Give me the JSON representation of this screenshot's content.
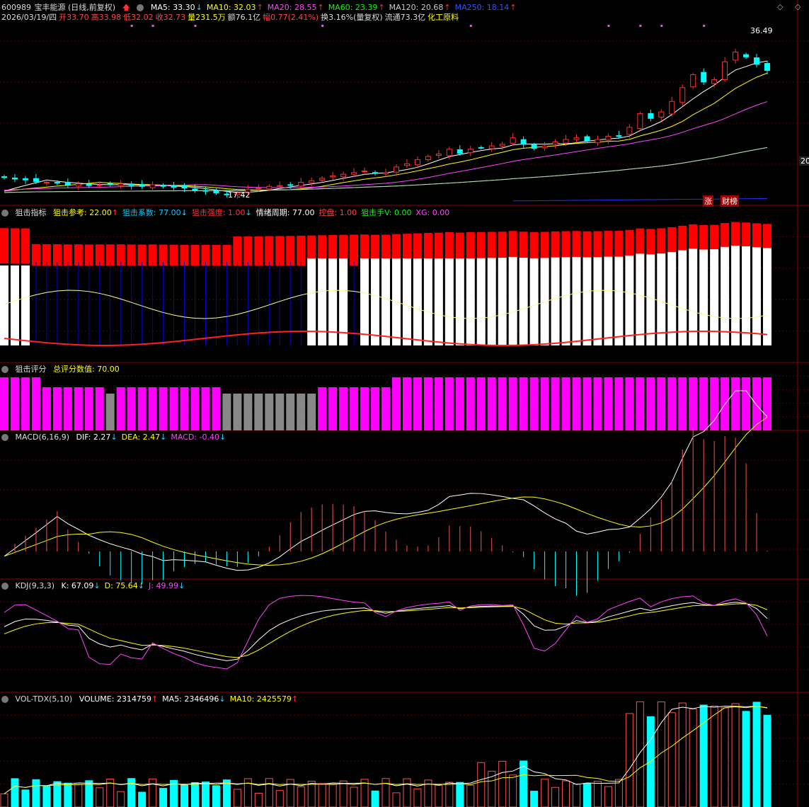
{
  "header": {
    "code": "600989",
    "name": "宝丰能源",
    "mode": "(日线,前复权)",
    "ma": [
      {
        "label": "MA5: 33.30",
        "dir": "down",
        "color": "#ffffff"
      },
      {
        "label": "MA10: 32.03",
        "dir": "up",
        "color": "#ffff00"
      },
      {
        "label": "MA20: 28.55",
        "dir": "up",
        "color": "#ff44ff"
      },
      {
        "label": "MA60: 23.39",
        "dir": "up",
        "color": "#00ff00"
      },
      {
        "label": "MA120: 20.68",
        "dir": "up",
        "color": "#cccccc"
      },
      {
        "label": "MA250: 18.14",
        "dir": "up",
        "color": "#3355ff"
      }
    ],
    "info": [
      {
        "t": "2026/03/19/四",
        "c": "#dddddd"
      },
      {
        "t": "开33.70",
        "c": "#ff4444"
      },
      {
        "t": "高33.98",
        "c": "#ff4444"
      },
      {
        "t": "低32.02",
        "c": "#ff4444"
      },
      {
        "t": "收32.73",
        "c": "#ff4444"
      },
      {
        "t": "量231.5万",
        "c": "#ffff00"
      },
      {
        "t": "额76.1亿",
        "c": "#dddddd"
      },
      {
        "t": "幅0.77(2.41%)",
        "c": "#ff4444"
      },
      {
        "t": "换3.16%(量复权)",
        "c": "#dddddd"
      },
      {
        "t": "流通73.3亿",
        "c": "#dddddd"
      },
      {
        "t": "化工原料",
        "c": "#ffff00"
      }
    ],
    "high_label": "36.49",
    "low_label": "17.42",
    "right_label": "20",
    "tag1": "涨",
    "tag2": "财榜"
  },
  "panel_sniper": {
    "title": "狙击指标",
    "items": [
      {
        "t": "狙击参考: 22.00",
        "c": "#ffff00",
        "dir": "up"
      },
      {
        "t": "狙击系数: 77.00",
        "c": "#00ccff",
        "dir": "down"
      },
      {
        "t": "狙击强度: 1.00",
        "c": "#ff3333",
        "dir": "down"
      },
      {
        "t": "情绪周期: 77.00",
        "c": "#ffffff",
        "dir": ""
      },
      {
        "t": "控盘: 1.00",
        "c": "#ff4444",
        "dir": ""
      },
      {
        "t": "狙击手V: 0.00",
        "c": "#00ff00",
        "dir": ""
      },
      {
        "t": "XG: 0.00",
        "c": "#ff44ff",
        "dir": ""
      }
    ]
  },
  "panel_score": {
    "title": "狙击评分",
    "items": [
      {
        "t": "总评分数值: 70.00",
        "c": "#ffff00",
        "dir": ""
      }
    ]
  },
  "panel_macd": {
    "title": "MACD(6,16,9)",
    "items": [
      {
        "t": "DIF: 2.27",
        "c": "#ffffff",
        "dir": "down"
      },
      {
        "t": "DEA: 2.47",
        "c": "#ffff00",
        "dir": "down"
      },
      {
        "t": "MACD: -0.40",
        "c": "#ff44ff",
        "dir": "down"
      }
    ]
  },
  "panel_kdj": {
    "title": "KDJ(9,3,3)",
    "items": [
      {
        "t": "K: 67.09",
        "c": "#ffffff",
        "dir": "down"
      },
      {
        "t": "D: 75.64",
        "c": "#ffff00",
        "dir": "down"
      },
      {
        "t": "J: 49.99",
        "c": "#ff44ff",
        "dir": "down"
      }
    ]
  },
  "panel_vol": {
    "title": "VOL-TDX(5,10)",
    "items": [
      {
        "t": "VOLUME: 2314759",
        "c": "#ffffff",
        "dir": "up"
      },
      {
        "t": "MA5: 2346496",
        "c": "#ffffff",
        "dir": "down"
      },
      {
        "t": "MA10: 2425579",
        "c": "#ffff00",
        "dir": "up"
      }
    ]
  },
  "chart_data": {
    "type": "candlestick",
    "n": 68,
    "price_range": [
      16.5,
      37.5
    ],
    "close": [
      19.5,
      19.3,
      19.2,
      19.0,
      18.9,
      18.8,
      18.6,
      18.7,
      18.5,
      18.6,
      18.6,
      18.7,
      18.5,
      18.4,
      18.6,
      18.4,
      18.3,
      18.2,
      17.9,
      17.8,
      17.6,
      17.42,
      17.6,
      18.0,
      18.2,
      18.4,
      18.5,
      18.6,
      18.9,
      19.1,
      19.4,
      19.7,
      19.9,
      20.1,
      20.3,
      20.0,
      20.1,
      20.8,
      21.2,
      21.7,
      22.1,
      22.4,
      23.0,
      22.5,
      23.0,
      23.2,
      23.4,
      23.6,
      24.4,
      23.6,
      23.1,
      23.4,
      23.9,
      24.2,
      24.4,
      24.0,
      24.2,
      24.6,
      24.6,
      25.7,
      27.4,
      26.8,
      27.6,
      28.9,
      30.6,
      32.2,
      31.3,
      31.6,
      33.8,
      35.0,
      34.4,
      33.5,
      32.73
    ],
    "bar_colors_up": "#ff3030",
    "bar_colors_down": "#00ffff"
  }
}
